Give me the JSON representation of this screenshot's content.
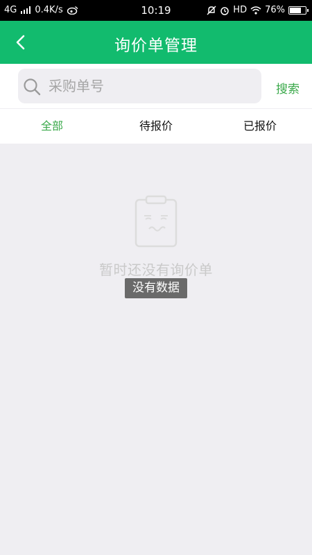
{
  "status_bar": {
    "network": "4G",
    "speed": "0.4K/s",
    "time": "10:19",
    "hd": "HD",
    "battery": "76%",
    "battery_level": 0.76
  },
  "nav": {
    "title": "询价单管理"
  },
  "search": {
    "placeholder": "采购单号",
    "value": "",
    "button_label": "搜索"
  },
  "tabs": [
    {
      "label": "全部",
      "active": true
    },
    {
      "label": "待报价",
      "active": false
    },
    {
      "label": "已报价",
      "active": false
    }
  ],
  "empty_state": {
    "message": "暂时还没有询价单"
  },
  "toast": {
    "text": "没有数据"
  },
  "colors": {
    "primary": "#12bb6e",
    "accent_text": "#3aa94a",
    "background": "#efeef2"
  }
}
